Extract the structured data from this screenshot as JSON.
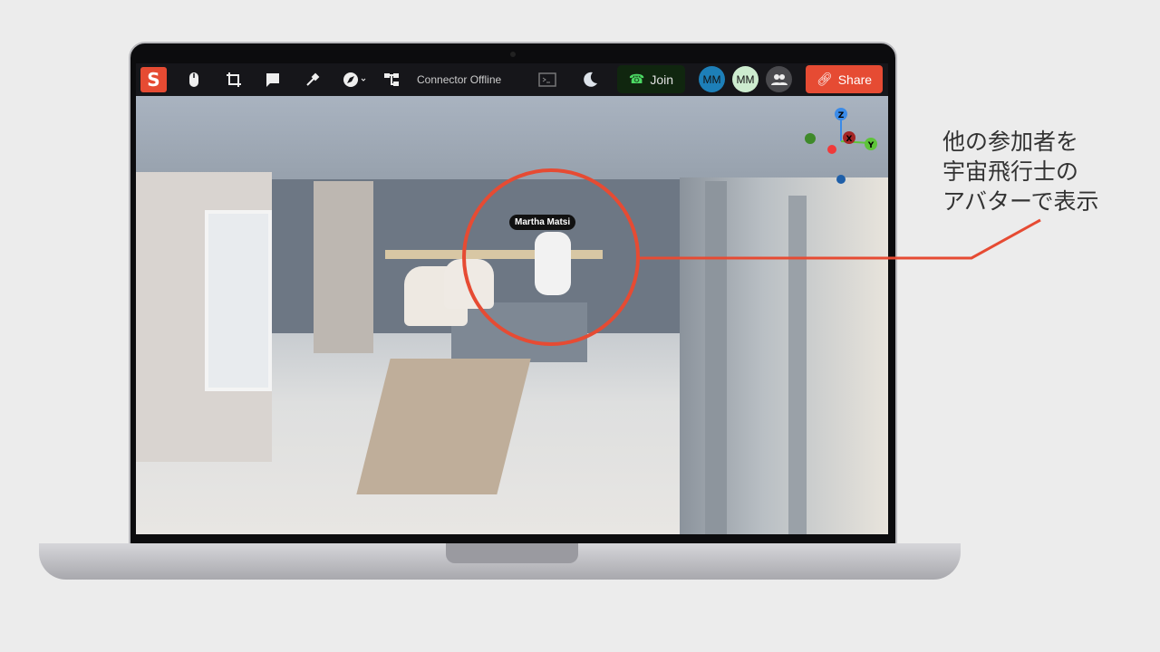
{
  "toolbar": {
    "logo": "S",
    "connector_status": "Connector Offline",
    "join_label": "Join",
    "participants": [
      {
        "initials": "MM",
        "color": "#1d7fb8"
      },
      {
        "initials": "MM",
        "color": "#cdeccf"
      }
    ],
    "share_label": "Share",
    "icons": [
      "mouse-icon",
      "crop-icon",
      "comment-icon",
      "eyedropper-icon",
      "compass-icon",
      "hierarchy-icon",
      "terminal-icon",
      "moon-icon",
      "phone-icon",
      "people-icon",
      "link-icon"
    ]
  },
  "viewport": {
    "avatar_name": "Martha Matsi",
    "axes": {
      "z": "Z",
      "x": "X",
      "y": "Y"
    }
  },
  "annotation": {
    "lines": [
      "他の参加者を",
      "宇宙飛行士の",
      "アバターで表示"
    ],
    "color": "#e64b33"
  }
}
